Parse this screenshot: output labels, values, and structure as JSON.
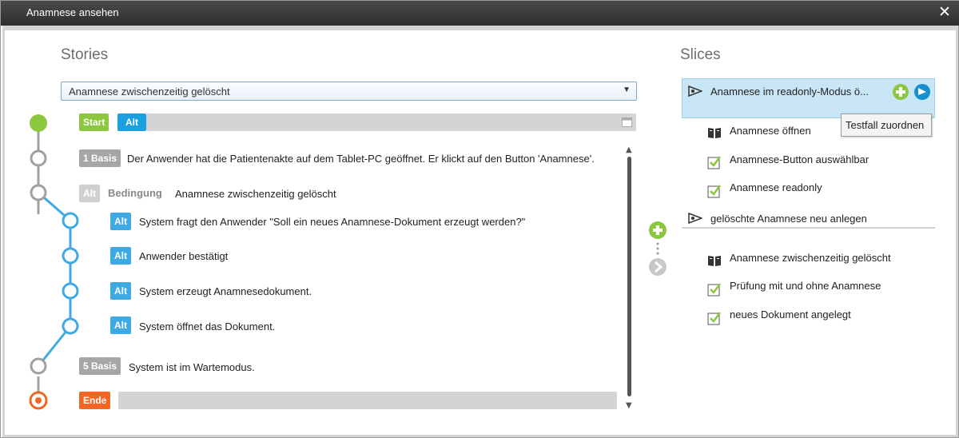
{
  "window": {
    "title": "Anamnese ansehen",
    "close_glyph": "✕"
  },
  "stories": {
    "heading": "Stories",
    "select": {
      "value": "Anamnese zwischenzeitig gelöscht",
      "arrow": "▼"
    },
    "start_badge": "Start",
    "start_alt_badge": "Alt",
    "steps": [
      {
        "badge": "1 Basis",
        "text": "Der Anwender hat die Patientenakte auf dem Tablet-PC geöffnet. Er klickt auf den Button 'Anamnese'."
      },
      {
        "badge": "Alt",
        "label": "Bedingung",
        "text": "Anamnese zwischenzeitig gelöscht"
      }
    ],
    "alt_steps": [
      {
        "badge": "Alt",
        "text": "System fragt den Anwender \"Soll ein neues Anamnese-Dokument erzeugt werden?\""
      },
      {
        "badge": "Alt",
        "text": "Anwender bestätigt"
      },
      {
        "badge": "Alt",
        "text": "System erzeugt Anamnesedokument."
      },
      {
        "badge": "Alt",
        "text": "System öffnet das Dokument."
      }
    ],
    "step5": {
      "badge": "5 Basis",
      "text": "System ist im Wartemodus."
    },
    "end_badge": "Ende",
    "scroll": {
      "up": "▲",
      "down": "▼"
    }
  },
  "slices": {
    "heading": "Slices",
    "selected": {
      "label": "Anamnese im readonly-Modus ö...",
      "tooltip": "Testfall zuordnen"
    },
    "selected_items": [
      {
        "icon": "book-icon",
        "text": "Anamnese öffnen"
      },
      {
        "icon": "check-icon",
        "text": "Anamnese-Button auswählbar"
      },
      {
        "icon": "check-icon",
        "text": "Anamnese readonly"
      }
    ],
    "second": {
      "label": "gelöschte Anamnese neu anlegen"
    },
    "second_items": [
      {
        "icon": "book-icon",
        "text": "Anamnese zwischenzeitig gelöscht"
      },
      {
        "icon": "check-icon",
        "text": "Prüfung mit und ohne Anamnese"
      },
      {
        "icon": "check-icon",
        "text": "neues Dokument angelegt"
      }
    ]
  },
  "colors": {
    "green": "#8dc63f",
    "blue": "#1aa0e0",
    "orange": "#f26522",
    "gray": "#a6a6a6"
  }
}
